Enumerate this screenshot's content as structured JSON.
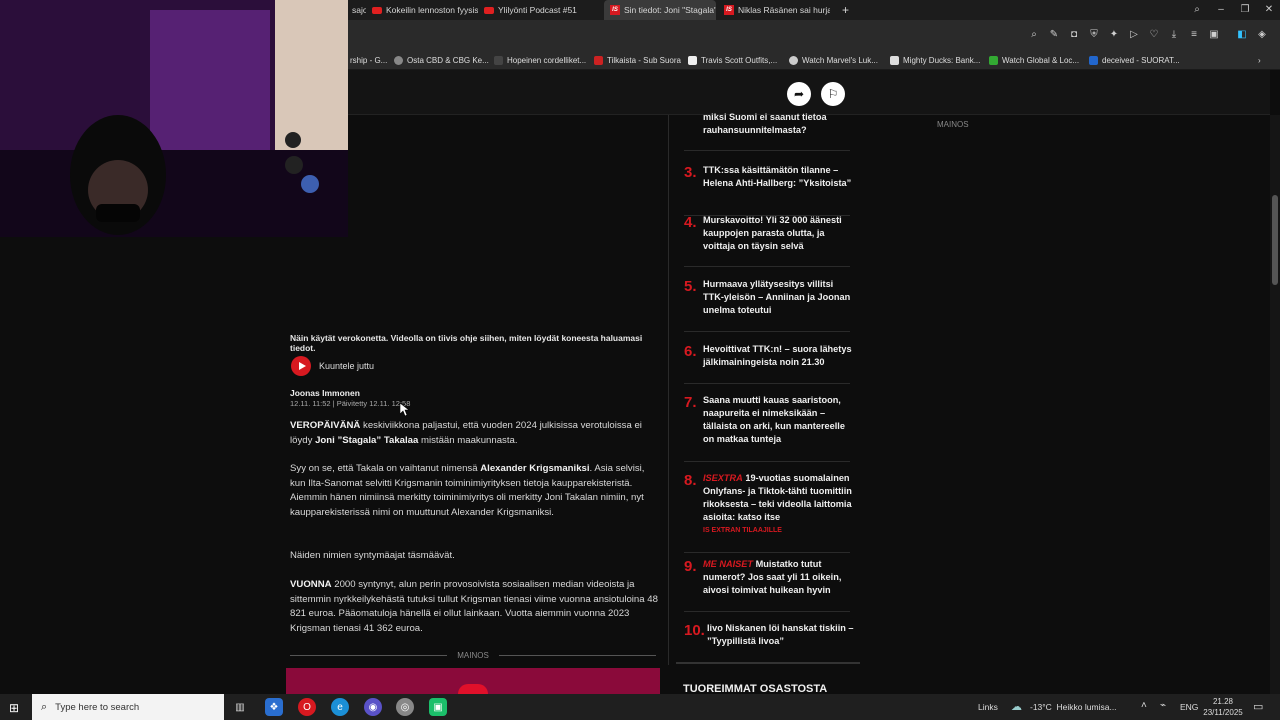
{
  "browser": {
    "tabs": [
      {
        "label": "sajo",
        "kind": "plain"
      },
      {
        "label": "Kokeilin lennoston fyysise",
        "kind": "yt"
      },
      {
        "label": "Ylilyönti Podcast #51",
        "kind": "yt"
      },
      {
        "label": "Sin tiedot: Joni \"Stagala\"",
        "kind": "is",
        "active": true
      },
      {
        "label": "Niklas Räsänen sai hurjan",
        "kind": "is"
      }
    ],
    "bookmarks": [
      {
        "label": "rship - G...",
        "color": "#777"
      },
      {
        "label": "Osta CBD & CBG Ke...",
        "color": "#888"
      },
      {
        "label": "Hopeinen cordelliket...",
        "color": "#444"
      },
      {
        "label": "Tilkaista - Sub Suora",
        "color": "#c22"
      },
      {
        "label": "Travis Scott Outfits,...",
        "color": "#eee"
      },
      {
        "label": "Watch Marvel's Luk...",
        "color": "#ccc"
      },
      {
        "label": "Mighty Ducks: Bank...",
        "color": "#ddd"
      },
      {
        "label": "Watch Global & Loc...",
        "color": "#3a3"
      },
      {
        "label": "deceived - SUORAT...",
        "color": "#26c"
      }
    ]
  },
  "article": {
    "caption": "Näin käytät verokonetta. Videolla on tiivis ohje siihen, miten löydät koneesta haluamasi tiedot.",
    "listen_label": "Kuuntele juttu",
    "author": "Joonas Immonen",
    "timestamp": "12.11. 11:52 | Päivitetty 12.11. 12:58",
    "p1_lead": "VEROPÄIVÄNÄ",
    "p1_a": " keskiviikkona paljastui, että vuoden 2024 julkisissa verotuloissa ei löydy ",
    "p1_name": "Joni ”Stagala” Takalaa",
    "p1_b": " mistään maakunnasta.",
    "p2_a": "Syy on se, että Takala on vaihtanut nimensä ",
    "p2_name": "Alexander Krigsmaniksi",
    "p2_b": ". Asia selvisi, kun Ilta-Sanomat selvitti Krigsmanin toiminimiyrityksen tietoja kaupparekisteristä. Aiemmin hänen nimiinsä merkitty toiminimiyritys oli merkitty Joni Takalan nimiin, nyt kaupparekisterissä nimi on muuttunut Alexander Krigsmaniksi.",
    "p3": "Näiden nimien syntymäajat täsmäävät.",
    "p4_lead": "VUONNA",
    "p4_b": " 2000 syntynyt, alun perin provosoivista sosiaalisen median videoista ja sittemmin nyrkkeilykehästä tutuksi tullut Krigsman tienasi viime vuonna ansiotuloina 48 821 euroa. Pääomatuloja hänellä ei ollut lainkaan. Vuotta aiemmin vuonna 2023 Krigsman tienasi 41 362 euroa.",
    "ad_label": "MAINOS"
  },
  "sidebar": {
    "top_item": "miksi Suomi ei saanut tietoa rauhansuunnitelmasta?",
    "ad_label": "MAINOS",
    "items": [
      {
        "num": "3.",
        "title": "TTK:ssa käsittämätön tilanne – Helena Ahti-Hallberg: ”Yksitoista”"
      },
      {
        "num": "4.",
        "title": "Murskavoitto! Yli 32 000 äänesti kauppojen parasta olutta, ja voittaja on täysin selvä"
      },
      {
        "num": "5.",
        "title": "Hurmaava yllätysesitys villitsi TTK-yleisön – Anniinan ja Joonan unelma toteutui"
      },
      {
        "num": "6.",
        "title": "Hevoittivat TTK:n! – suora lähetys jälkimainingeista noin 21.30"
      },
      {
        "num": "7.",
        "title": "Saana muutti kauas saaristoon, naapureita ei nimeksikään – tällaista on arki, kun mantereelle on matkaa tunteja"
      },
      {
        "num": "8.",
        "tag": "ISEXTRA",
        "title": " 19-vuotias suomalainen Onlyfans- ja Tiktok-tähti tuomittiin rikoksesta – teki videolla laittomia asioita: katso itse",
        "sub": "IS EXTRAN TILAAJILLE"
      },
      {
        "num": "9.",
        "tag": "ME NAISET",
        "title": " Muistatko tutut numerot? Jos saat yli 11 oikein, aivosi toimivat huikean hyvin"
      },
      {
        "num": "10.",
        "title": "Iivo Niskanen löi hanskat tiskiin – ”Tyypillistä Iivoa”"
      }
    ],
    "footer_heading": "TUOREIMMAT OSASTOSTA"
  },
  "taskbar": {
    "search_placeholder": "Type here to search",
    "links_label": "Links",
    "weather": "-13°C  Heikko lumisa...",
    "language": "ENG",
    "time": "21.28",
    "date": "23/11/2025"
  }
}
